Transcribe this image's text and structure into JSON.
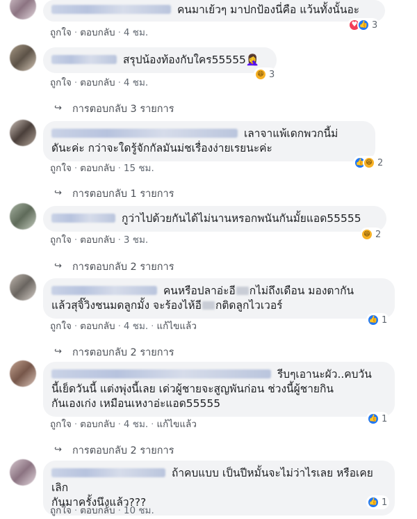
{
  "comments": [
    {
      "text": "คนมาเย้วๆ มาปกป้องนี่คือ แว้นทั้งนั้นอะ",
      "actions": {
        "like": "ถูกใจ",
        "reply": "ตอบกลับ",
        "time": "4 ชม."
      },
      "reactions": {
        "icons": [
          "love-icon",
          "like-icon"
        ],
        "count": "3"
      }
    },
    {
      "text": "สรุปน้องท้องกับใคร55555🤦‍♀️",
      "actions": {
        "like": "ถูกใจ",
        "reply": "ตอบกลับ",
        "time": "4 ชม."
      },
      "reactions": {
        "icons": [
          "haha-icon"
        ],
        "count": "3"
      },
      "replies_label": "การตอบกลับ 3 รายการ"
    },
    {
      "text_line1": "เลาจาแพ้เดกพวกนี้ม่",
      "text_line2": "ดันะค่ะ กว่าจะใดรู้จักกัลมันม่ชเรื่องง่ายเรยนะค่ะ",
      "actions": {
        "like": "ถูกใจ",
        "reply": "ตอบกลับ",
        "time": "15 ชม."
      },
      "reactions": {
        "icons": [
          "like-icon",
          "haha-icon"
        ],
        "count": "2"
      },
      "replies_label": "การตอบกลับ 1 รายการ"
    },
    {
      "text": "กูว่าไปด้วยกันได้ไม่นานหรอกพนันกันมั้ยแอด55555",
      "actions": {
        "like": "ถูกใจ",
        "reply": "ตอบกลับ",
        "time": "3 ชม."
      },
      "reactions": {
        "icons": [
          "haha-icon"
        ],
        "count": "2"
      },
      "replies_label": "การตอบกลับ 2 รายการ"
    },
    {
      "text_line1a": "คนหรือปลาอ่ะอี",
      "text_line1b": "กไม่ถึงเดือน มองตากัน",
      "text_line2a": "แล้วสุจิ๊วิงชนมดลูกมั้ง จะร้องไห้อี",
      "text_line2b": "กติดลูกไวเวอร์",
      "actions": {
        "like": "ถูกใจ",
        "reply": "ตอบกลับ",
        "time": "4 ชม.",
        "edited": "แก้ไขแล้ว"
      },
      "reactions": {
        "icons": [
          "like-icon"
        ],
        "count": "1"
      },
      "replies_label": "การตอบกลับ 2 รายการ"
    },
    {
      "text_line1": "รีบๆเอานะผัว..คบวัน",
      "text_line2": "นี้เย็ดวันนี้ แต่งพุ่งนี้เลย เด่วผู้ชายจะสูญพันก่อน ช่วงนี้ผู้ชายกิน",
      "text_line3": "กันเองเก่ง เหมือนเหงาอ่ะแอด55555",
      "actions": {
        "like": "ถูกใจ",
        "reply": "ตอบกลับ",
        "time": "4 ชม.",
        "edited": "แก้ไขแล้ว"
      },
      "reactions": {
        "icons": [
          "like-icon"
        ],
        "count": "1"
      },
      "replies_label": "การตอบกลับ 2 รายการ"
    },
    {
      "text_line1": "ถ้าคบแบบ เป็นปีหมั้นจะไม่ว่าไรเลย หรือเคยเลิก",
      "text_line2": "กันมาครั้งนึงแล้ว???",
      "actions": {
        "like": "ถูกใจ",
        "reply": "ตอบกลับ",
        "time": "10 ชม."
      },
      "reactions": {
        "icons": [
          "like-icon"
        ],
        "count": "1"
      }
    }
  ]
}
